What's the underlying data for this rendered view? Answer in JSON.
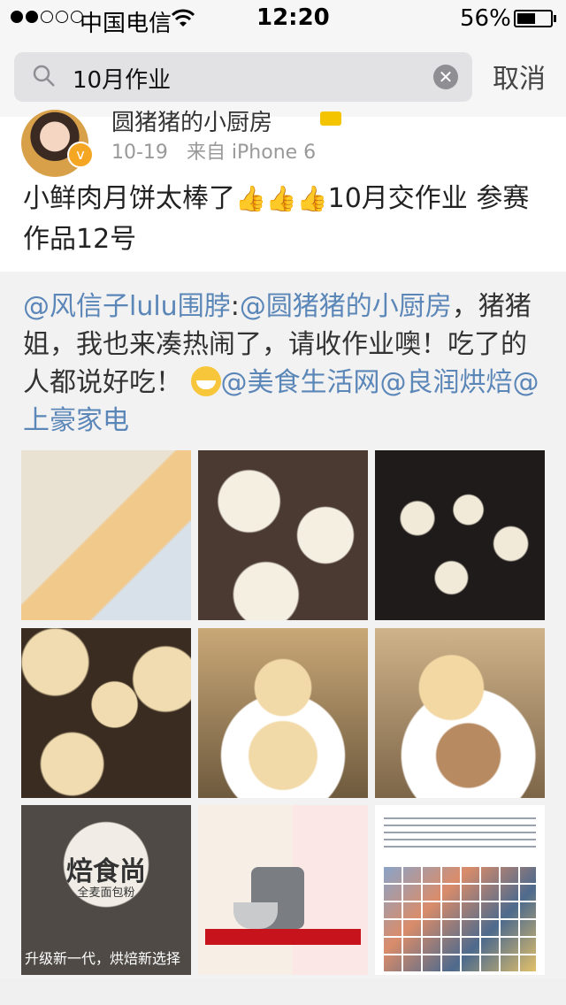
{
  "status_bar": {
    "signal_filled": 2,
    "signal_total": 5,
    "carrier": "中国电信",
    "time": "12:20",
    "battery_percent": "56%",
    "battery_level": 0.56
  },
  "search": {
    "query": "10月作业",
    "cancel_label": "取消"
  },
  "post": {
    "username": "圆猪猪的小厨房",
    "date": "10-19",
    "source": "来自 iPhone 6",
    "text_before": "小鲜肉月饼太棒了",
    "thumb_emoji": "👍",
    "text_after": "10月交作业 参赛作品12号"
  },
  "repost": {
    "author": "@风信子lulu围脖",
    "colon": ":",
    "mention_1": "@圆猪猪的小厨房",
    "body": "，猪猪姐，我也来凑热闹了，请收作业噢！吃了的人都说好吃！",
    "mention_2": "@美食生活网",
    "mention_3": "@良润烘焙",
    "mention_4": "@上豪家电"
  },
  "images": {
    "brand_name": "焙食尚",
    "brand_sub": "全麦面包粉",
    "brand_slogan": "升级新一代，烘焙新选择"
  },
  "colors": {
    "mention": "#5b86b8",
    "verify_badge": "#f5a623"
  },
  "icons": [
    "search-icon",
    "clear-icon",
    "wifi-icon",
    "battery-icon",
    "verified-icon",
    "vip-icon",
    "thumbs-up-icon",
    "grin-emoji-icon"
  ]
}
